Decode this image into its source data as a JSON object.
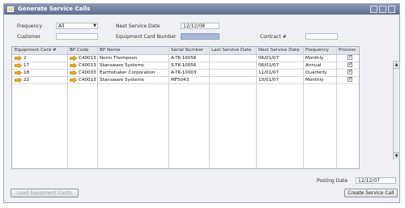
{
  "window": {
    "title": "Generate Service Calls"
  },
  "filters": {
    "frequency_label": "Frequency",
    "frequency_value": "All",
    "customer_label": "Customer",
    "next_service_date_label": "Next Service Date",
    "next_service_date_value": "12/12/08",
    "equipment_card_number_label": "Equipment Card Number",
    "contract_label": "Contract #"
  },
  "table": {
    "columns": [
      "Equipment Card #",
      "BP Code",
      "BP Name",
      "Serial Number",
      "Last Service Date",
      "Next Service Date",
      "Frequency",
      "Process"
    ],
    "rows": [
      {
        "equipment_card": "2",
        "bp_code": "C40013",
        "bp_name": "Norm Thompson",
        "serial": "A-TK-10056",
        "last_service": "",
        "next_service": "06/01/07",
        "frequency": "Monthly",
        "process": true
      },
      {
        "equipment_card": "17",
        "bp_code": "C40013",
        "bp_name": "Stansware Systems",
        "serial": "S-TK-10056",
        "last_service": "",
        "next_service": "06/01/07",
        "frequency": "Annual",
        "process": true
      },
      {
        "equipment_card": "18",
        "bp_code": "C40003",
        "bp_name": "Earthshaker Corporation",
        "serial": "A-TK-10003",
        "last_service": "",
        "next_service": "11/01/07",
        "frequency": "Quarterly",
        "process": true
      },
      {
        "equipment_card": "22",
        "bp_code": "C40013",
        "bp_name": "Stansware Systems",
        "serial": "MF5043",
        "last_service": "",
        "next_service": "10/01/07",
        "frequency": "Monthly",
        "process": true
      }
    ]
  },
  "footer": {
    "posting_date_label": "Posting Date",
    "posting_date_value": "12/12/07",
    "load_button": "Load Equipment Cards",
    "create_button": "Create Service Call"
  },
  "colors": {
    "titlebar": "#5e6d8e",
    "accent_field": "#a8b9d8",
    "link_arrow": "#e6a817"
  }
}
